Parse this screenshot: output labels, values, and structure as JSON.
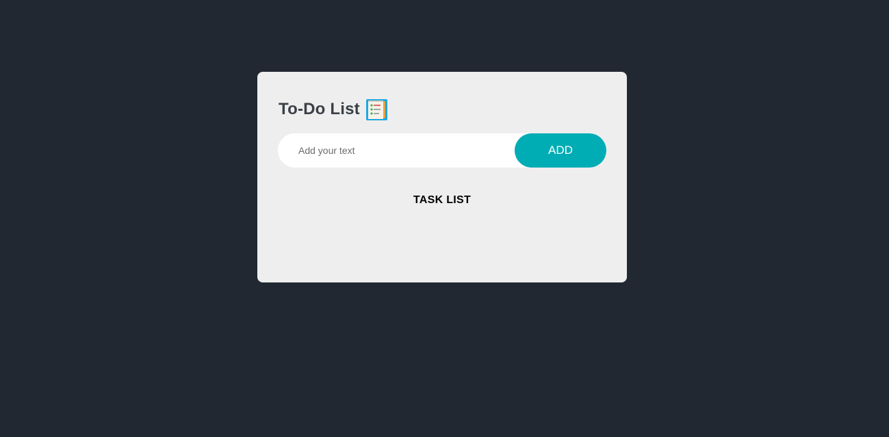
{
  "app": {
    "title": "To-Do List",
    "title_icon": "checklist-notepad-icon"
  },
  "input": {
    "placeholder": "Add your text",
    "value": ""
  },
  "add_button": {
    "label": "ADD"
  },
  "task_list": {
    "heading": "TASK LIST",
    "items": []
  },
  "colors": {
    "background": "#222831",
    "card": "#eeeeee",
    "accent": "#00adb5",
    "title_text": "#3b3f46"
  }
}
